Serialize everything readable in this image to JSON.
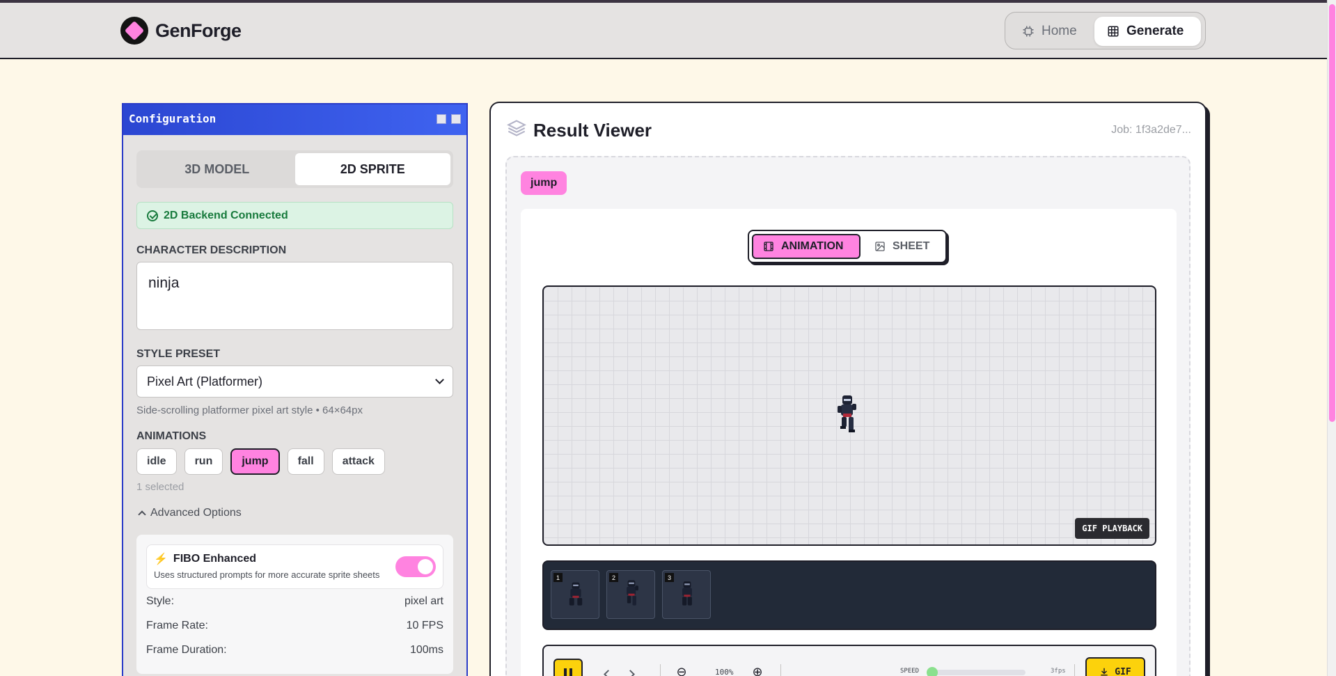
{
  "app": {
    "name": "GenForge",
    "accent": "#ff83e0"
  },
  "nav": {
    "home_label": "Home",
    "generate_label": "Generate"
  },
  "config": {
    "title": "Configuration",
    "mode_tabs": [
      {
        "label": "3D MODEL",
        "active": false
      },
      {
        "label": "2D SPRITE",
        "active": true
      }
    ],
    "status": "2D Backend Connected",
    "character_label": "CHARACTER DESCRIPTION",
    "character_value": "ninja",
    "style_label": "STYLE PRESET",
    "style_value": "Pixel Art (Platformer)",
    "style_hint": "Side-scrolling platformer pixel art style • 64×64px",
    "animations_label": "ANIMATIONS",
    "animations": [
      {
        "label": "idle",
        "selected": false
      },
      {
        "label": "run",
        "selected": false
      },
      {
        "label": "jump",
        "selected": true
      },
      {
        "label": "fall",
        "selected": false
      },
      {
        "label": "attack",
        "selected": false
      }
    ],
    "selected_count": "1 selected",
    "advanced_label": "Advanced Options",
    "fibo": {
      "title": "FIBO Enhanced",
      "subtitle": "Uses structured prompts for more accurate sprite sheets",
      "enabled": true
    },
    "details": [
      {
        "key": "Style:",
        "value": "pixel art"
      },
      {
        "key": "Frame Rate:",
        "value": "10 FPS"
      },
      {
        "key": "Frame Duration:",
        "value": "100ms"
      }
    ]
  },
  "result": {
    "title": "Result Viewer",
    "job": "Job: 1f3a2de7...",
    "animation_tag": "jump",
    "view_tabs": [
      {
        "label": "ANIMATION",
        "active": true
      },
      {
        "label": "SHEET",
        "active": false
      }
    ],
    "playback_badge": "GIF PLAYBACK",
    "frames": [
      "1",
      "2",
      "3"
    ],
    "controls": {
      "zoom": "100%",
      "speed_label": "SPEED",
      "speed_value": "3fps",
      "export_label": "GIF"
    }
  }
}
